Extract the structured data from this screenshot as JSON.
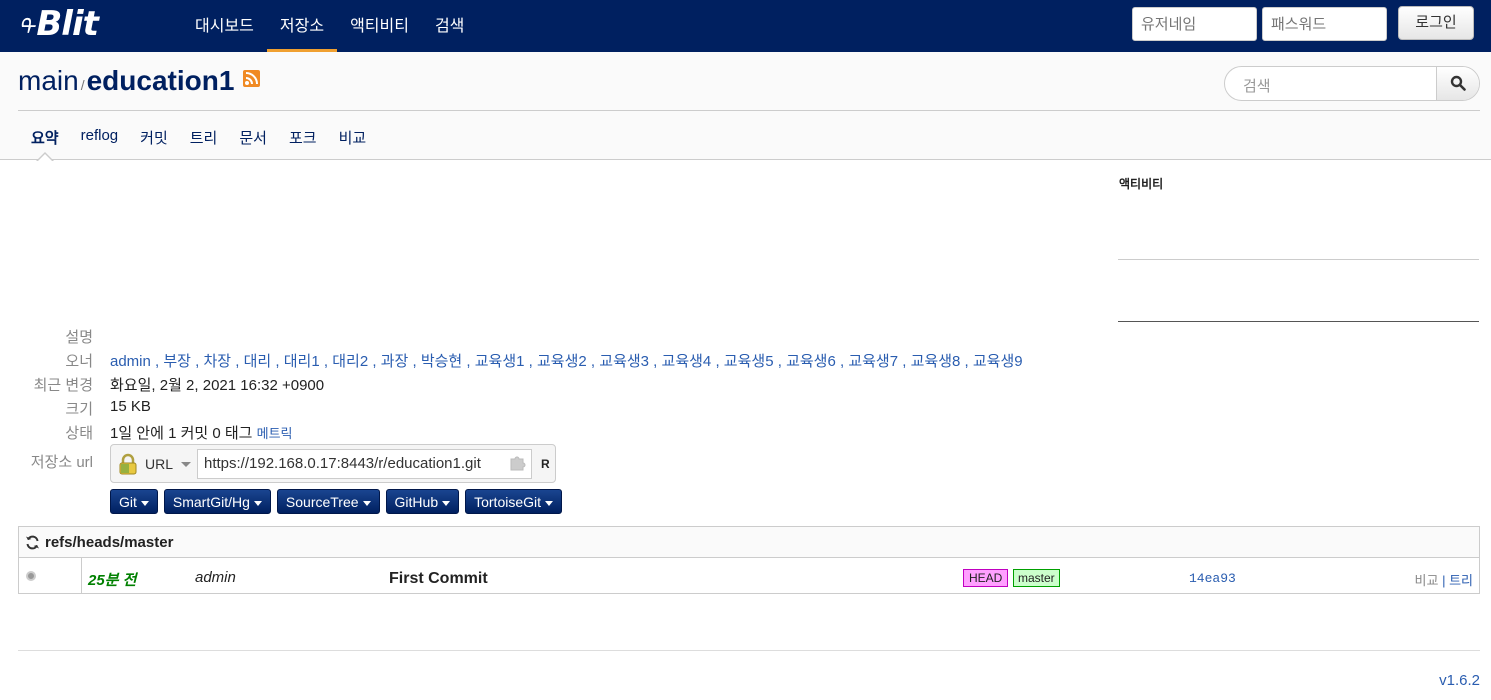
{
  "nav": {
    "brand": "Blit",
    "brand_prefix": "ᠲ",
    "items": [
      "대시보드",
      "저장소",
      "액티비티",
      "검색"
    ],
    "active_index": 1,
    "username_placeholder": "유저네임",
    "password_placeholder": "패스워드",
    "login_label": "로그인"
  },
  "repo": {
    "project": "main",
    "separator": "/",
    "name": "education1",
    "search_placeholder": "검색",
    "tabs": [
      "요약",
      "reflog",
      "커밋",
      "트리",
      "문서",
      "포크",
      "비교"
    ],
    "active_tab": 0
  },
  "activity": {
    "title": "액티비티"
  },
  "summary": {
    "labels": {
      "description": "설명",
      "owner": "오너",
      "last_change": "최근 변경",
      "size": "크기",
      "status": "상태",
      "url": "저장소 url"
    },
    "description": "",
    "owners": [
      "admin",
      "부장",
      "차장",
      "대리",
      "대리1",
      "대리2",
      "과장",
      "박승현",
      "교육생1",
      "교육생2",
      "교육생3",
      "교육생4",
      "교육생5",
      "교육생6",
      "교육생7",
      "교육생8",
      "교육생9"
    ],
    "last_change": "화요일, 2월 2, 2021 16:32 +0900",
    "size": "15 KB",
    "status": "1일 안에 1 커밋 0 태그",
    "metrics_link": "메트릭",
    "url_protocol": "URL",
    "url": "https://192.168.0.17:8443/r/education1.git",
    "permission": "R",
    "clients": [
      "Git",
      "SmartGit/Hg",
      "SourceTree",
      "GitHub",
      "TortoiseGit"
    ]
  },
  "log": {
    "ref": "refs/heads/master",
    "rows": [
      {
        "age": "25분 전",
        "author": "admin",
        "message": "First Commit",
        "refs": [
          "HEAD",
          "master"
        ],
        "sha": "14ea93",
        "link_compare": "비교",
        "link_separator": "|",
        "link_tree": "트리"
      }
    ]
  },
  "footer": {
    "version": "v1.6.2"
  },
  "colors": {
    "navbar": "#002060",
    "accent": "#f0a030",
    "link": "#2a5db0",
    "age": "#008000"
  }
}
